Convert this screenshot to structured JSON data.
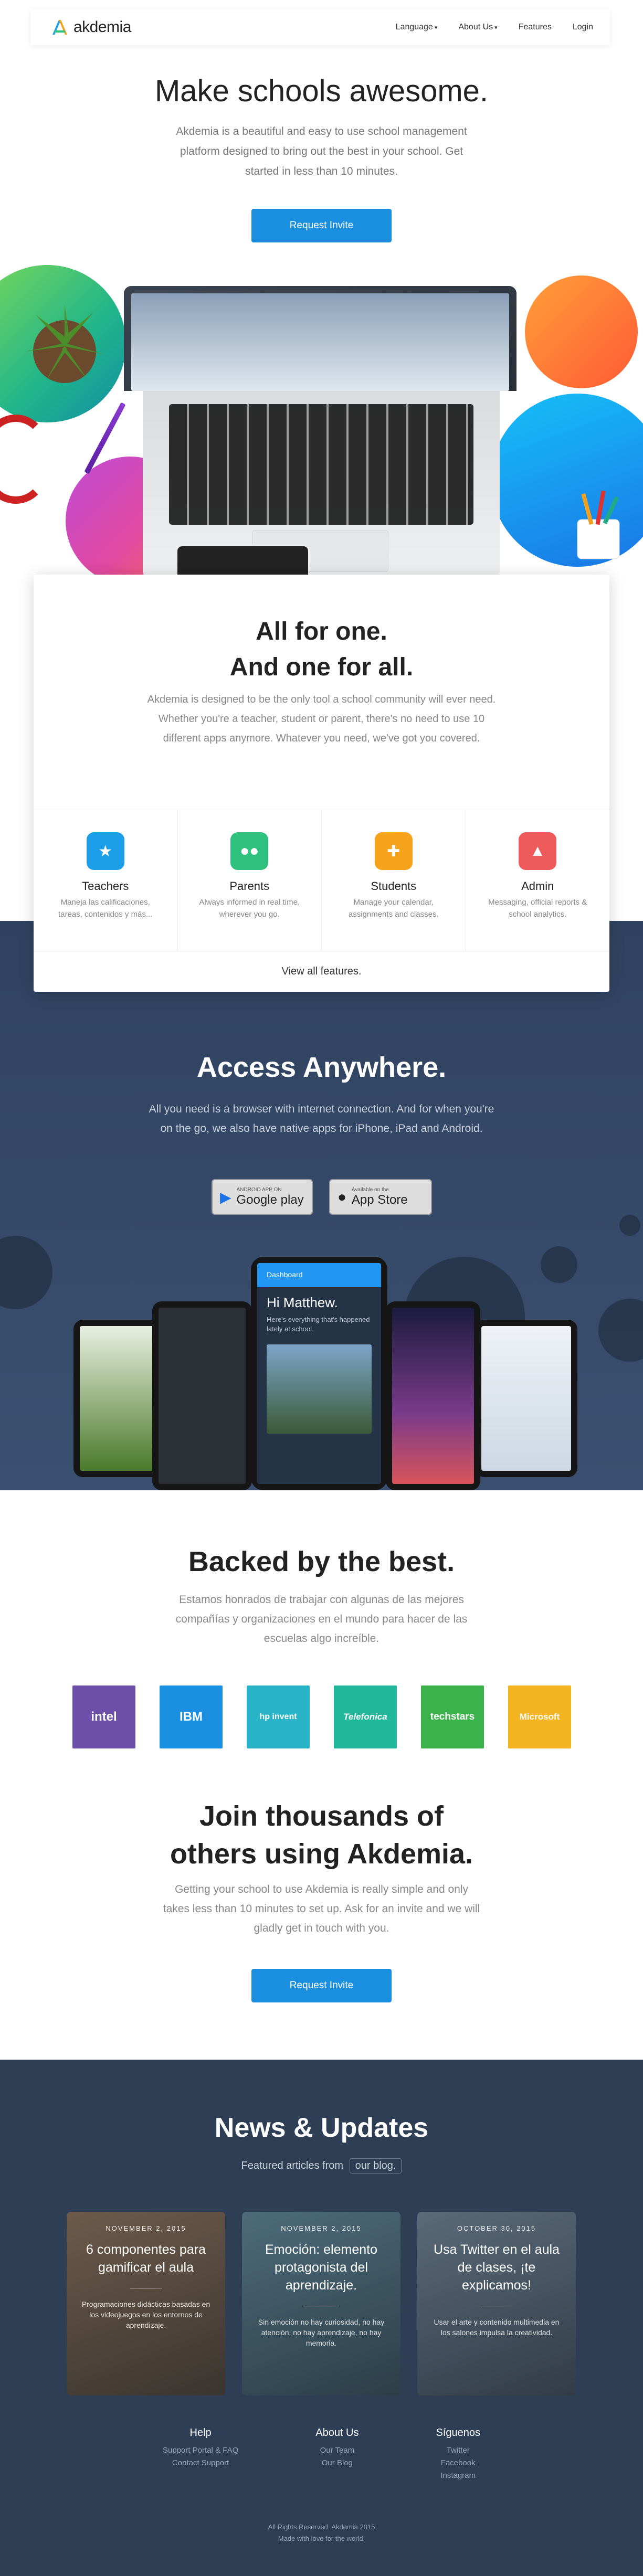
{
  "nav": {
    "brand": "akdemia",
    "links": [
      {
        "label": "Language",
        "caret": "▾"
      },
      {
        "label": "About Us",
        "caret": "▾"
      },
      {
        "label": "Features",
        "caret": ""
      },
      {
        "label": "Login",
        "caret": ""
      }
    ]
  },
  "hero": {
    "title": "Make schools awesome.",
    "subtitle": "Akdemia is a beautiful and easy to use school management platform designed to bring out the best in your school. Get started in less than 10 minutes.",
    "cta": "Request Invite"
  },
  "all_for_one": {
    "title_line1": "All for one.",
    "title_line2": "And one for all.",
    "subtitle": "Akdemia is designed to be the only tool a school community will ever need. Whether you're a teacher, student or parent, there's no need to use 10 different apps anymore. Whatever you need, we've got you covered.",
    "features": [
      {
        "title": "Teachers",
        "desc": "Maneja las calificaciones, tareas, contenidos y más...",
        "color": "#1d9ee8",
        "icon": "teachers-icon"
      },
      {
        "title": "Parents",
        "desc": "Always informed in real time, wherever you go.",
        "color": "#2ec27e",
        "icon": "parents-icon"
      },
      {
        "title": "Students",
        "desc": "Manage your calendar, assignments and classes.",
        "color": "#f7a21b",
        "icon": "students-icon"
      },
      {
        "title": "Admin",
        "desc": "Messaging, official reports & school analytics.",
        "color": "#ef5a5a",
        "icon": "admin-icon"
      }
    ],
    "view_all": "View all features."
  },
  "access": {
    "title": "Access Anywhere.",
    "subtitle": "All you need is a browser with internet connection. And for when you're on the go, we also have native apps for iPhone, iPad and Android.",
    "google_play_small": "ANDROID APP ON",
    "google_play_big": "Google play",
    "app_store_small": "Available on the",
    "app_store_big": "App Store",
    "phone_greeting": "Hi Matthew.",
    "phone_sub": "Here's everything that's happened lately at school.",
    "phone_header": "Dashboard"
  },
  "backed": {
    "title": "Backed by the best.",
    "subtitle": "Estamos honrados de trabajar con algunas de las mejores compañías y organizaciones en el mundo para hacer de las escuelas algo increíble.",
    "partners": [
      {
        "name": "intel",
        "color": "#6b4fa8"
      },
      {
        "name": "IBM",
        "color": "#1b8fe0"
      },
      {
        "name": "hp invent",
        "color": "#26b4c6"
      },
      {
        "name": "Telefonica",
        "color": "#21b79b"
      },
      {
        "name": "techstars",
        "color": "#3bb24a"
      },
      {
        "name": "Microsoft",
        "color": "#f5b521"
      }
    ]
  },
  "join": {
    "title_line1": "Join thousands of",
    "title_line2": "others using Akdemia.",
    "subtitle": "Getting your school to use Akdemia is really simple and only takes less than 10 minutes to set up. Ask for an invite and we will gladly get in touch with you.",
    "cta": "Request Invite"
  },
  "news": {
    "title": "News & Updates",
    "subtitle": "Featured articles from",
    "blog_tag": "our blog.",
    "cards": [
      {
        "date": "NOVEMBER 2, 2015",
        "headline": "6 componentes para gamificar el aula",
        "text": "Programaciones didácticas basadas en los videojuegos en los entornos de aprendizaje."
      },
      {
        "date": "NOVEMBER 2, 2015",
        "headline": "Emoción: elemento protagonista del aprendizaje.",
        "text": "Sin emoción no hay curiosidad, no hay atención, no hay aprendizaje, no hay memoria."
      },
      {
        "date": "OCTOBER 30, 2015",
        "headline": "Usa Twitter en el aula de clases, ¡te explicamos!",
        "text": "Usar el arte y contenido multimedia en los salones impulsa la creatividad."
      }
    ]
  },
  "footer": {
    "cols": [
      {
        "title": "Help",
        "items": [
          "Support Portal & FAQ",
          "Contact Support"
        ]
      },
      {
        "title": "About Us",
        "items": [
          "Our Team",
          "Our Blog"
        ]
      },
      {
        "title": "Síguenos",
        "items": [
          "Twitter",
          "Facebook",
          "Instagram"
        ]
      }
    ],
    "copyright": "All Rights Reserved, Akdemia 2015",
    "made_with": "Made with love for the world."
  }
}
